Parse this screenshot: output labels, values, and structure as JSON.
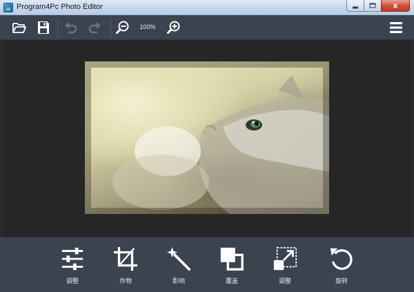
{
  "window": {
    "title": "Program4Pc Photo Editor",
    "close_glyph": "x"
  },
  "toolbar": {
    "zoom_level": "100%",
    "buttons": [
      {
        "name": "open-folder-icon"
      },
      {
        "name": "save-icon"
      },
      {
        "name": "undo-icon",
        "enabled": false
      },
      {
        "name": "redo-icon",
        "enabled": false
      },
      {
        "name": "zoom-out-icon"
      },
      {
        "name": "zoom-in-icon"
      },
      {
        "name": "hamburger-menu-icon"
      }
    ]
  },
  "canvas": {
    "photo_subject": "cat"
  },
  "tools": [
    {
      "label": "调整",
      "icon": "sliders-icon"
    },
    {
      "label": "作物",
      "icon": "crop-icon"
    },
    {
      "label": "影响",
      "icon": "magic-wand-icon"
    },
    {
      "label": "覆盖",
      "icon": "overlay-icon"
    },
    {
      "label": "调整",
      "icon": "resize-icon"
    },
    {
      "label": "旋转",
      "icon": "rotate-icon"
    }
  ],
  "colors": {
    "toolbar_bg": "#3c4350",
    "canvas_bg": "#262626",
    "icon": "#ffffff",
    "disabled_icon": "#6b7280"
  }
}
